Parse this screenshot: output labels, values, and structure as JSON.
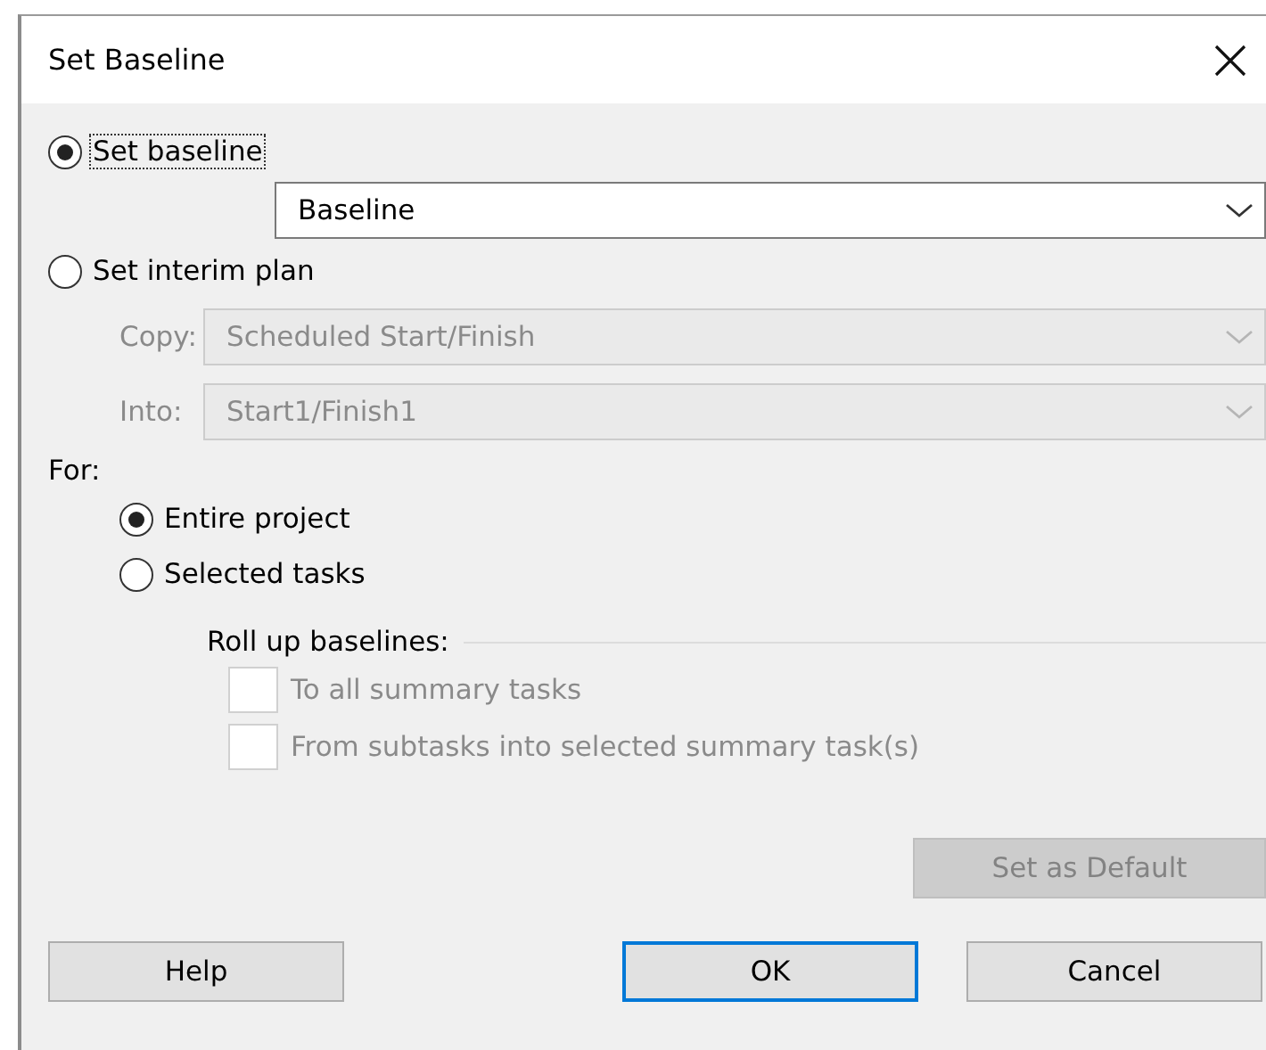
{
  "window": {
    "title": "Set Baseline"
  },
  "mode_options": [
    {
      "label": "Set baseline",
      "selected": true,
      "focused": true
    },
    {
      "label": "Set interim plan",
      "selected": false,
      "focused": false
    }
  ],
  "baseline_select": {
    "value": "Baseline",
    "disabled": false
  },
  "interim_fields": [
    {
      "label": "Copy:",
      "value": "Scheduled Start/Finish",
      "disabled": true
    },
    {
      "label": "Into:",
      "value": "Start1/Finish1",
      "disabled": true
    }
  ],
  "for_group": {
    "label": "For:",
    "options": [
      {
        "label": "Entire project",
        "selected": true
      },
      {
        "label": "Selected tasks",
        "selected": false
      }
    ]
  },
  "roll_up": {
    "title": "Roll up baselines:",
    "options": [
      {
        "label": "To all summary tasks",
        "checked": false,
        "disabled": true
      },
      {
        "label": "From subtasks into selected summary task(s)",
        "checked": false,
        "disabled": true
      }
    ]
  },
  "set_default_button": {
    "label": "Set as Default",
    "disabled": true
  },
  "footer_buttons": [
    {
      "label": "Help",
      "default": false
    },
    {
      "label": "OK",
      "default": true
    },
    {
      "label": "Cancel",
      "default": false
    }
  ]
}
